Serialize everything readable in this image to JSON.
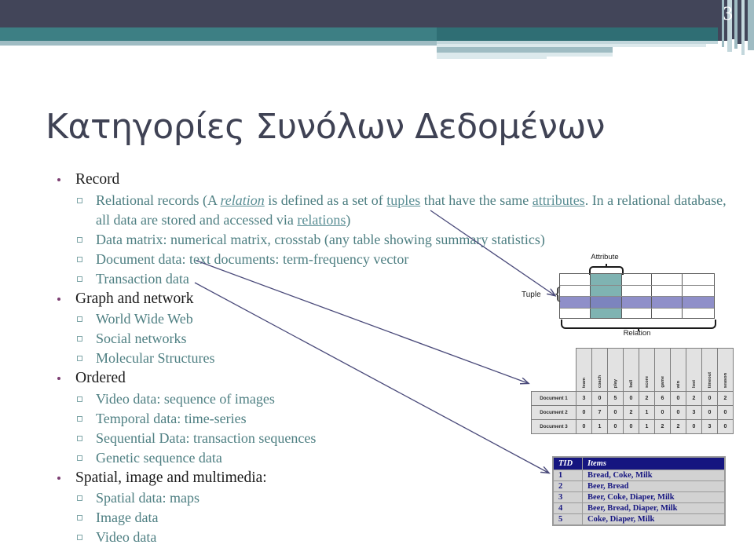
{
  "slide": {
    "number": "3",
    "title": "Κατηγορίες Συνόλων Δεδομένων"
  },
  "theme": {
    "navy": "#424559",
    "teal": "#3d7f84",
    "steel": "#9fbcc3",
    "title_color": "#3f4254",
    "level1_color": "#1b1b1b",
    "level2_color": "#4e7f82",
    "link_color": "#5b8f95",
    "bullet1_color": "#7c3f72",
    "arrow_color": "#4a4a7a"
  },
  "outline": [
    {
      "label": "Record",
      "children": [
        {
          "id": "relational",
          "parts": [
            {
              "t": "Relational records (A ",
              "k": "plain"
            },
            {
              "t": "relation",
              "k": "link-italic"
            },
            {
              "t": " is defined as a set of ",
              "k": "plain"
            },
            {
              "t": "tuples",
              "k": "link"
            },
            {
              "t": " that have the same ",
              "k": "plain"
            },
            {
              "t": "attributes",
              "k": "link"
            },
            {
              "t": ".  In a relational database, all data are stored and accessed via ",
              "k": "plain"
            },
            {
              "t": "relations",
              "k": "link"
            },
            {
              "t": ")",
              "k": "plain"
            }
          ]
        },
        {
          "id": "datamatrix",
          "text": "Data matrix: numerical matrix, crosstab (any table showing summary statistics)"
        },
        {
          "id": "document",
          "text": "Document data: text documents: term-frequency vector"
        },
        {
          "id": "transaction",
          "text": "Transaction data"
        }
      ]
    },
    {
      "label": "Graph and network",
      "children": [
        {
          "id": "www",
          "text": "World Wide Web"
        },
        {
          "id": "social",
          "text": "Social networks"
        },
        {
          "id": "molecular",
          "text": "Molecular Structures"
        }
      ]
    },
    {
      "label": "Ordered",
      "children": [
        {
          "id": "video",
          "text": "Video data: sequence of images"
        },
        {
          "id": "temporal",
          "text": "Temporal data: time-series"
        },
        {
          "id": "sequential",
          "text": "Sequential Data: transaction sequences"
        },
        {
          "id": "genetic",
          "text": "Genetic sequence data"
        }
      ]
    },
    {
      "label": "Spatial, image and multimedia:",
      "children": [
        {
          "id": "spatial",
          "text": "Spatial data: maps"
        },
        {
          "id": "image",
          "text": "Image data"
        },
        {
          "id": "videodata",
          "text": "Video data"
        }
      ]
    }
  ],
  "figures": {
    "relation_diagram": {
      "attribute_caption": "Attribute",
      "tuple_caption": "Tuple",
      "tuple_brace": "{",
      "relation_caption": "Relation",
      "columns": 5,
      "rows": 4,
      "highlight_column_index": 1,
      "highlight_row_index": 2,
      "column_highlight_color": "#69a6a4",
      "row_highlight_color": "#7b7bbf"
    },
    "document_matrix": {
      "terms": [
        "team",
        "coach",
        "play",
        "ball",
        "score",
        "game",
        "win",
        "lost",
        "timeout",
        "season"
      ],
      "rows": [
        {
          "label": "Document 1",
          "values": [
            3,
            0,
            5,
            0,
            2,
            6,
            0,
            2,
            0,
            2
          ]
        },
        {
          "label": "Document 2",
          "values": [
            0,
            7,
            0,
            2,
            1,
            0,
            0,
            3,
            0,
            0
          ]
        },
        {
          "label": "Document 3",
          "values": [
            0,
            1,
            0,
            0,
            1,
            2,
            2,
            0,
            3,
            0
          ]
        }
      ]
    },
    "transaction_table": {
      "headers": [
        "TID",
        "Items"
      ],
      "rows": [
        {
          "tid": "1",
          "items": "Bread, Coke, Milk"
        },
        {
          "tid": "2",
          "items": "Beer, Bread"
        },
        {
          "tid": "3",
          "items": "Beer, Coke, Diaper, Milk"
        },
        {
          "tid": "4",
          "items": "Beer, Bread, Diaper, Milk"
        },
        {
          "tid": "5",
          "items": "Coke, Diaper, Milk"
        }
      ]
    }
  }
}
